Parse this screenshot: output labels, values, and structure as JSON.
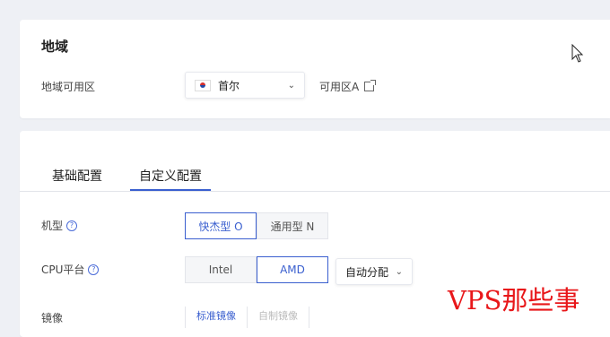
{
  "region_card": {
    "title": "地域",
    "zone_label": "地域可用区",
    "region_value": "首尔",
    "zone_link": "可用区A"
  },
  "config_card": {
    "tabs": [
      {
        "label": "基础配置"
      },
      {
        "label": "自定义配置"
      }
    ],
    "instance_type": {
      "label": "机型",
      "options": [
        "快杰型 O",
        "通用型 N"
      ],
      "selected": "快杰型 O"
    },
    "cpu_platform": {
      "label": "CPU平台",
      "options": [
        "Intel",
        "AMD"
      ],
      "selected": "AMD",
      "allocation": "自动分配"
    },
    "image": {
      "label": "镜像",
      "tabs": [
        "标准镜像",
        "自制镜像"
      ]
    }
  },
  "watermark": "VPS那些事",
  "colors": {
    "accent": "#3a5fcf",
    "background": "#eef0f5",
    "watermark": "#e8171a"
  },
  "icons": {
    "flag": "south-korea-flag-icon",
    "chevron": "chevron-down-icon",
    "external": "external-link-icon",
    "help": "help-circle-icon",
    "cursor": "mouse-pointer-icon"
  }
}
